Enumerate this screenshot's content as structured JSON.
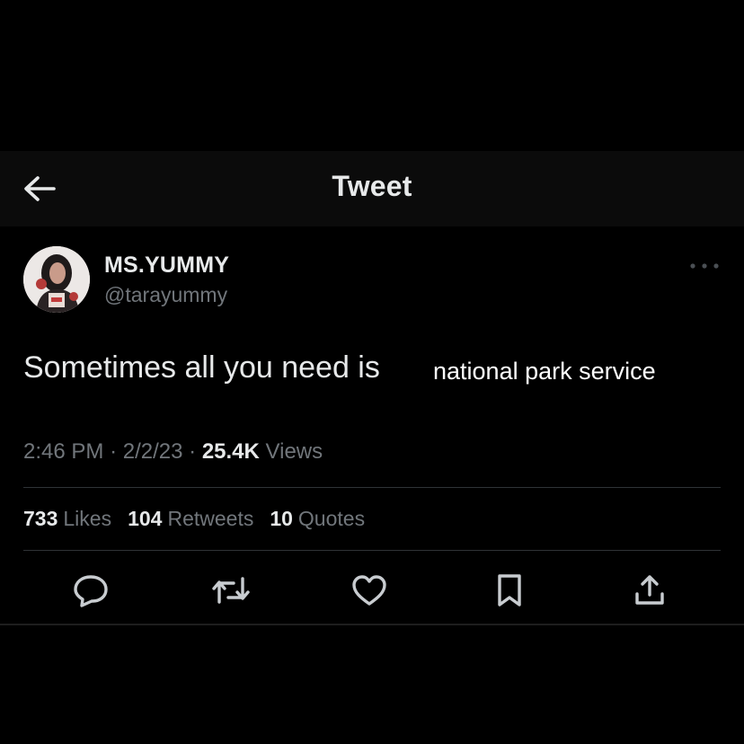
{
  "header": {
    "title": "Tweet",
    "back_icon": "arrow-left-icon"
  },
  "author": {
    "display_name": "MS.YUMMY",
    "handle": "@tarayummy",
    "more_icon": "more-horizontal-icon"
  },
  "tweet": {
    "text": "Sometimes all you need is",
    "overlay_text": "national park service"
  },
  "meta": {
    "time": "2:46 PM",
    "separator": "·",
    "date": "2/2/23",
    "views_count": "25.4K",
    "views_label": "Views"
  },
  "stats": {
    "likes_count": "733",
    "likes_label": "Likes",
    "retweets_count": "104",
    "retweets_label": "Retweets",
    "quotes_count": "10",
    "quotes_label": "Quotes"
  },
  "actions": {
    "reply_icon": "reply-icon",
    "retweet_icon": "retweet-icon",
    "like_icon": "heart-icon",
    "bookmark_icon": "bookmark-icon",
    "share_icon": "share-icon"
  },
  "colors": {
    "background": "#000000",
    "header_bg": "#0b0b0b",
    "primary_text": "#e7e9ea",
    "secondary_text": "#71767b",
    "divider": "#2f3336"
  }
}
